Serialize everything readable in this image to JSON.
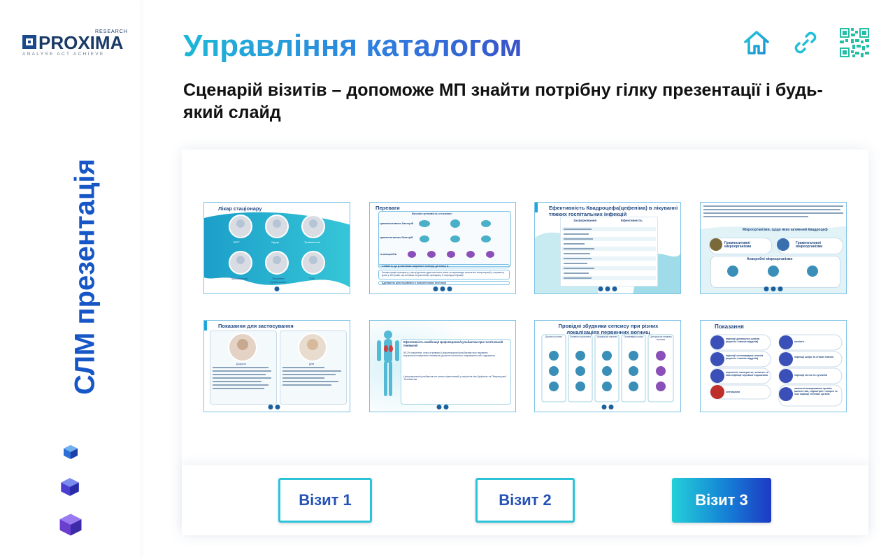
{
  "logo": {
    "word": "PROXIMA",
    "research": "RESEARCH",
    "tagline": "ANALYSE  ACT  ACHIEVE"
  },
  "sidebar": {
    "vertical_title": "СЛМ презентація"
  },
  "header": {
    "title": "Управління каталогом",
    "subtitle": "Сценарій візитів – допоможе МП знайти потрібну гілку презентації і будь-який слайд",
    "icons": [
      "home-icon",
      "link-icon",
      "qr-code-icon"
    ]
  },
  "slides": [
    {
      "title": "Лікар стаціонару",
      "labels": [
        "ВРІТ",
        "Хірург",
        "Травматолог",
        "Пульмонолог",
        "Терапевт/ пульмонолог",
        "УЗЛ"
      ]
    },
    {
      "title": "Переваги",
      "lines": [
        "Висока чутливість стосовно:",
        "грампозитивних бактерій",
        "грамнегативних бактерій",
        "та анаеробів",
        "Стійкість до β-лактамаз широкого спектру дії класу А",
        "Концентрація препарату у місці досягає дуже високого рівня та перевищує аналогічні концентрації у сироватці крові у 100 разів, що впливає потраплянню препарату в осередок інфекції",
        "Адекватна ціна порівняно з аналогічними агентами"
      ]
    },
    {
      "title": "Ефективність Квадроцефа(цефепіма) в лікуванні тяжких госпітальних інфекцій",
      "col1": "Захворювання",
      "col2": "Ефективність"
    },
    {
      "title": "Мікроорганізми, щодо яких активний Квадроцеф",
      "labels": [
        "Грампозитивні мікроорганізми",
        "Грамнегативні мікроорганізми",
        "Анаеробні мікроорганізми"
      ]
    },
    {
      "title": "Показання для застосування",
      "labels": [
        "Дорослі",
        "Діти"
      ]
    },
    {
      "title": "Ефективність комбінації Цефоперазон/сульбактам при госпітальній пневмонії",
      "lines": [
        "80,3% пацієнтів, котрі отримали Цефоперазон/сульбактам при лікуванні внутрішньолікарняної пневмонії досягли клінічного покращення або одужання;",
        "Цефоперазон/сульбактам не менш ефективний у пацієнтів ніж Цефепім та Піперацилін/Тазобактам"
      ]
    },
    {
      "title": "Провідні збудники сепсису при різних локалізаціях первинних вогнищ",
      "labels": [
        "Дихальні шляхи",
        "Черевна порожнина",
        "Шкіра/м'які тканини",
        "Сечовивідні шляхи",
        "Центральна нервова система"
      ]
    },
    {
      "title": "Показання",
      "labels": [
        "інфекції дихальних шляхів (верхніх і нижніх відділів)",
        "інфекції сечовивідних шляхів (верхніх і нижніх відділів)",
        "перитоніт, холецистит, холангіт та інші інфекції черевної порожнини",
        "септицемія",
        "менінгіт",
        "інфекції шкіри та м'яких тканин",
        "інфекції кісток та суглобів",
        "запальні захворювання органів малого таза, ендометрит, гонорея та інші інфекції статевих органів"
      ]
    }
  ],
  "visits": [
    "Візит 1",
    "Візит 2",
    "Візит 3"
  ],
  "colors": {
    "accent": "#1656c6",
    "teal": "#2cc3d8"
  }
}
